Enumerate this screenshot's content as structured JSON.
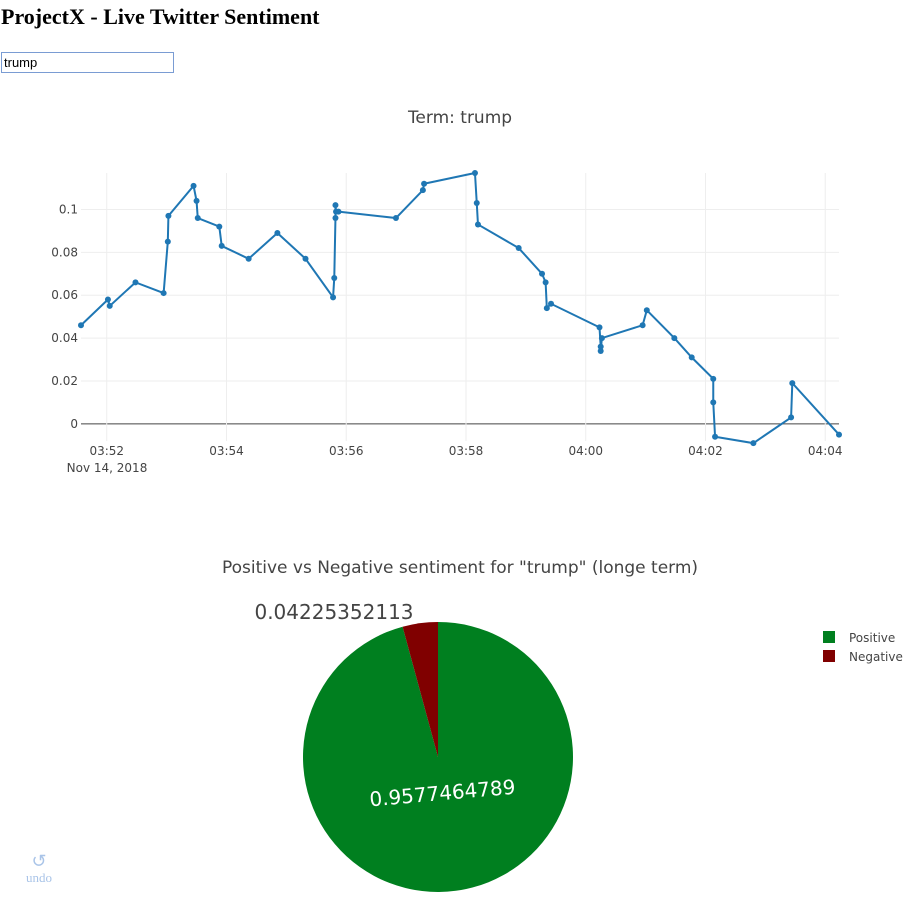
{
  "page": {
    "title": "ProjectX - Live Twitter Sentiment"
  },
  "search": {
    "value": "trump"
  },
  "undo": {
    "label": "undo",
    "icon": "undo-icon"
  },
  "colors": {
    "line": "#1f77b4",
    "positive": "#007f1f",
    "negative": "#800000",
    "axis_text": "#444444"
  },
  "chart_data": [
    {
      "type": "line",
      "title": "Term: trump",
      "xlabel": "",
      "ylabel": "",
      "x_ticks": [
        "03:52",
        "03:54",
        "03:56",
        "03:58",
        "04:00",
        "04:02",
        "04:04"
      ],
      "x_date_label": "Nov 14, 2018",
      "y_ticks": [
        "0",
        "0.02",
        "0.04",
        "0.06",
        "0.08",
        "0.1"
      ],
      "xlim_minutes_after_0352": [
        -0.43,
        12.23
      ],
      "ylim": [
        -0.008,
        0.117
      ],
      "grid": true,
      "series": [
        {
          "x_minutes_after_0352": [
            -0.43,
            0.02,
            0.05,
            0.48,
            0.95,
            1.02,
            1.03,
            1.45,
            1.5,
            1.52,
            1.88,
            1.92,
            2.37,
            2.85,
            3.32,
            3.78,
            3.8,
            3.82,
            3.82,
            3.83,
            3.87,
            4.83,
            5.28,
            5.3,
            6.15,
            6.18,
            6.2,
            6.88,
            7.27,
            7.33,
            7.35,
            7.42,
            8.23,
            8.25,
            8.25,
            8.27,
            8.95,
            9.02,
            9.48,
            9.77,
            10.13,
            10.13,
            10.16,
            10.8,
            11.43,
            11.45,
            12.23
          ],
          "y": [
            0.046,
            0.058,
            0.055,
            0.066,
            0.061,
            0.085,
            0.097,
            0.111,
            0.104,
            0.096,
            0.092,
            0.083,
            0.077,
            0.089,
            0.077,
            0.059,
            0.068,
            0.096,
            0.102,
            0.099,
            0.099,
            0.096,
            0.109,
            0.112,
            0.117,
            0.103,
            0.093,
            0.082,
            0.07,
            0.066,
            0.054,
            0.056,
            0.045,
            0.036,
            0.034,
            0.04,
            0.046,
            0.053,
            0.04,
            0.031,
            0.021,
            0.01,
            -0.006,
            -0.009,
            0.003,
            0.019,
            -0.005
          ]
        }
      ]
    },
    {
      "type": "pie",
      "title": "Positive vs Negative sentiment for \"trump\" (longe term)",
      "labels": [
        "Positive",
        "Negative"
      ],
      "values": [
        0.9577464789,
        0.04225352113
      ],
      "value_labels": [
        "0.9577464789",
        "0.04225352113"
      ],
      "legend_position": "top-right"
    }
  ]
}
